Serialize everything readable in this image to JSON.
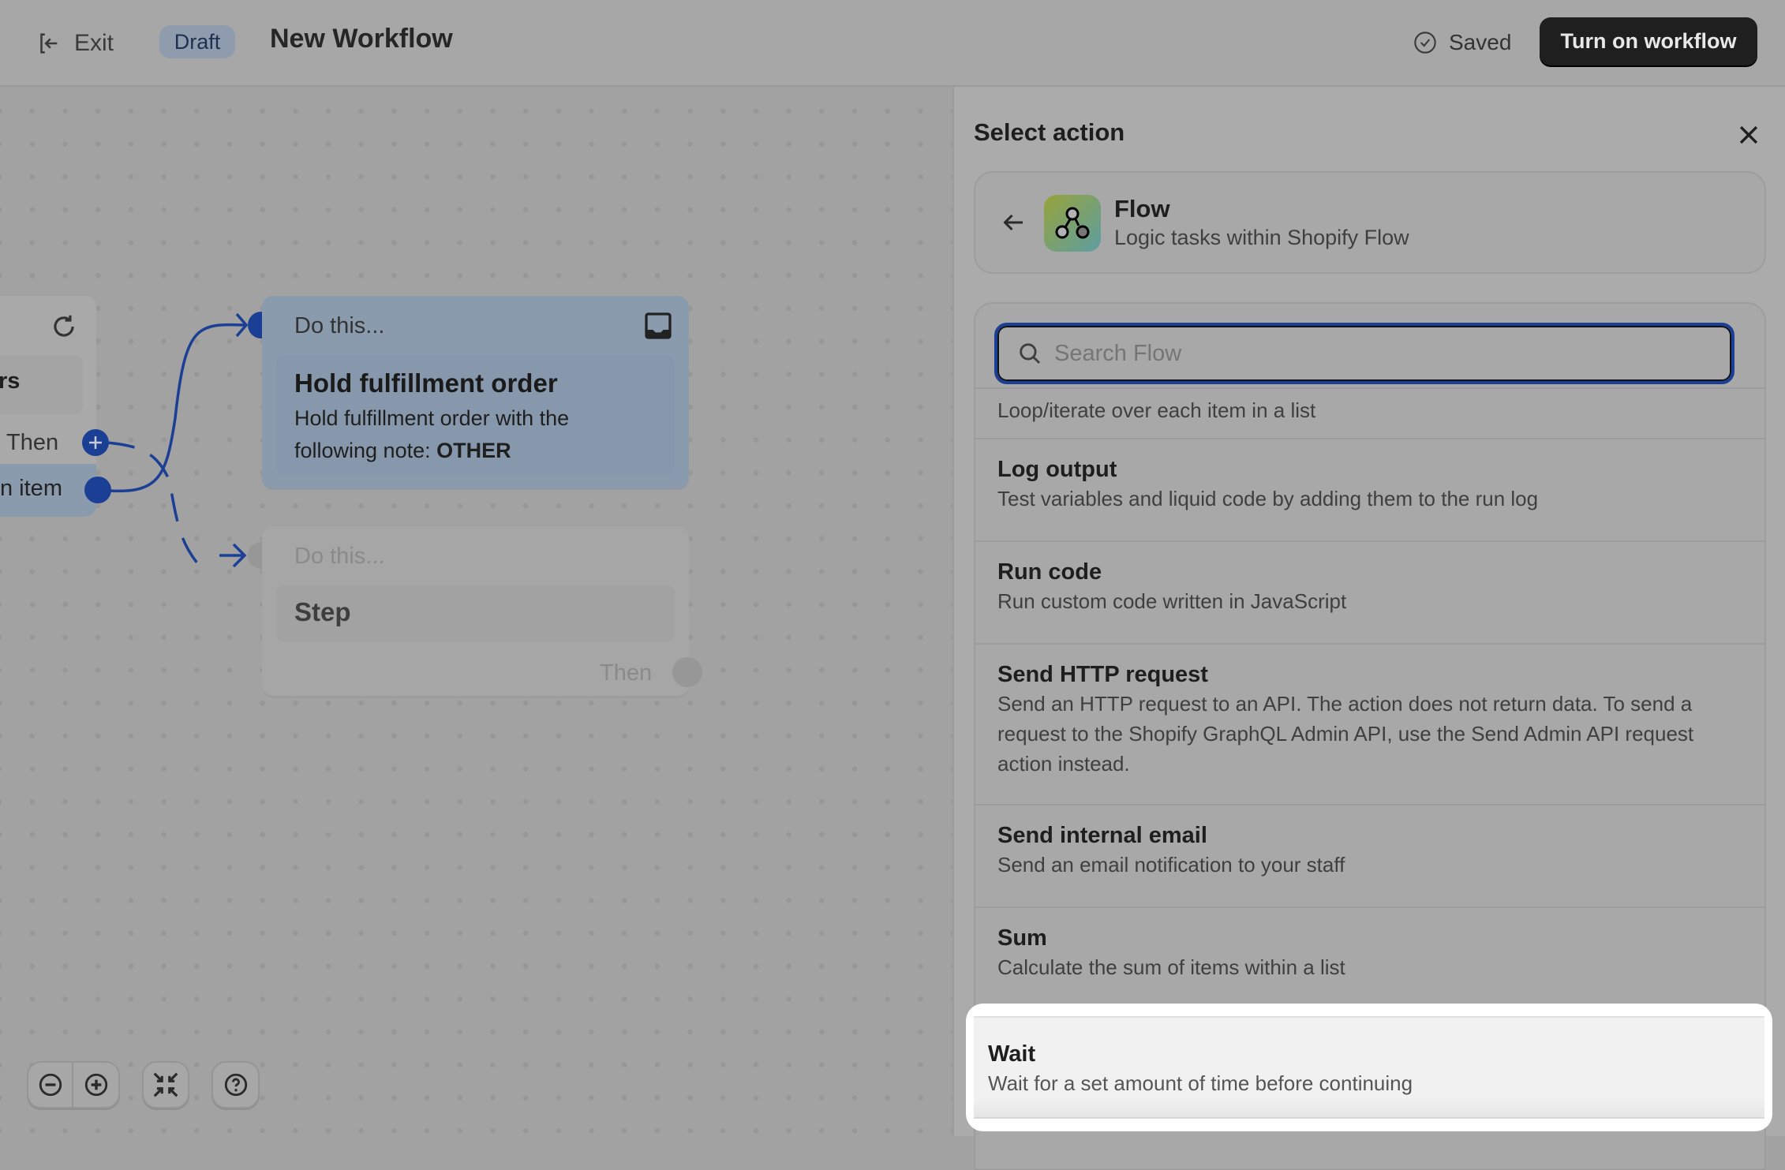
{
  "topbar": {
    "exit_label": "Exit",
    "status_badge": "Draft",
    "title": "New Workflow",
    "saved_label": "Saved",
    "turn_on_label": "Turn on workflow"
  },
  "canvas": {
    "left_node": {
      "partial_label": "rs",
      "then_label": "Then",
      "item_label": "n item"
    },
    "hold_node": {
      "header": "Do this...",
      "title": "Hold fulfillment order",
      "desc": "Hold fulfillment order with the following note: ",
      "desc_bold": "OTHER"
    },
    "step_node": {
      "header": "Do this...",
      "title": "Step",
      "then_label": "Then"
    }
  },
  "panel": {
    "title": "Select action",
    "app": {
      "name": "Flow",
      "desc": "Logic tasks within Shopify Flow"
    },
    "search": {
      "placeholder": "Search Flow",
      "value": ""
    },
    "partial_item_desc": "Loop/iterate over each item in a list",
    "items": [
      {
        "title": "Log output",
        "desc": "Test variables and liquid code by adding them to the run log"
      },
      {
        "title": "Run code",
        "desc": "Run custom code written in JavaScript"
      },
      {
        "title": "Send HTTP request",
        "desc": "Send an HTTP request to an API. The action does not return data. To send a request to the Shopify GraphQL Admin API, use the Send Admin API request action instead."
      },
      {
        "title": "Send internal email",
        "desc": "Send an email notification to your staff"
      },
      {
        "title": "Sum",
        "desc": "Calculate the sum of items within a list"
      },
      {
        "title": "Wait",
        "desc": "Wait for a set amount of time before continuing"
      }
    ]
  },
  "colors": {
    "accent": "#1b3f94",
    "primary_button": "#1f1f1f",
    "node_active": "#8b9bae",
    "highlight": "#f1f1f1"
  }
}
